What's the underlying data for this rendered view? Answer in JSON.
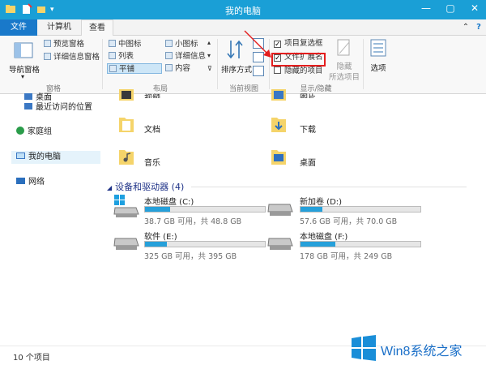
{
  "window": {
    "title": "我的电脑"
  },
  "tabs": {
    "file": "文件",
    "computer": "计算机",
    "view": "查看"
  },
  "ribbon": {
    "nav_pane": "导航窗格",
    "preview_pane": "预览窗格",
    "details_pane": "详细信息窗格",
    "panes_group": "窗格",
    "layout_items": [
      "中图标",
      "小图标",
      "列表",
      "详细信息",
      "平铺",
      "内容"
    ],
    "layout_group": "布局",
    "sort_by": "排序方式",
    "current_view_group": "当前视图",
    "item_checkboxes": "项目复选框",
    "file_extensions": "文件扩展名",
    "hidden_items": "隐藏的项目",
    "hide_selected_line1": "隐藏",
    "hide_selected_line2": "所选项目",
    "show_hide_group": "显示/隐藏",
    "options": "选项",
    "checkmark": "✓"
  },
  "navigation": {
    "desktop": "桌面",
    "recent_places": "最近访问的位置",
    "homegroup": "家庭组",
    "this_pc": "我的电脑",
    "network": "网络"
  },
  "folders": {
    "top_left_partial": "视频",
    "top_right_partial": "图片",
    "documents": "文档",
    "downloads": "下载",
    "music": "音乐",
    "desktop": "桌面"
  },
  "devices": {
    "header": "设备和驱动器 (4)",
    "drives": [
      {
        "name": "本地磁盘 (C:)",
        "info": "38.7 GB 可用，共 48.8 GB",
        "used": 0.21,
        "windows_logo": true
      },
      {
        "name": "新加卷 (D:)",
        "info": "57.6 GB 可用，共 70.0 GB",
        "used": 0.18
      },
      {
        "name": "软件 (E:)",
        "info": "325 GB 可用，共 395 GB",
        "used": 0.18
      },
      {
        "name": "本地磁盘 (F:)",
        "info": "178 GB 可用，共 249 GB",
        "used": 0.29
      }
    ]
  },
  "status": {
    "item_count": "10 个项目"
  },
  "watermark": {
    "text": "Win8系统之家"
  },
  "colors": {
    "accent": "#1a9fd6",
    "file_tab": "#1979ca",
    "drive_fill": "#26a0da",
    "highlight": "#e41d1d"
  }
}
